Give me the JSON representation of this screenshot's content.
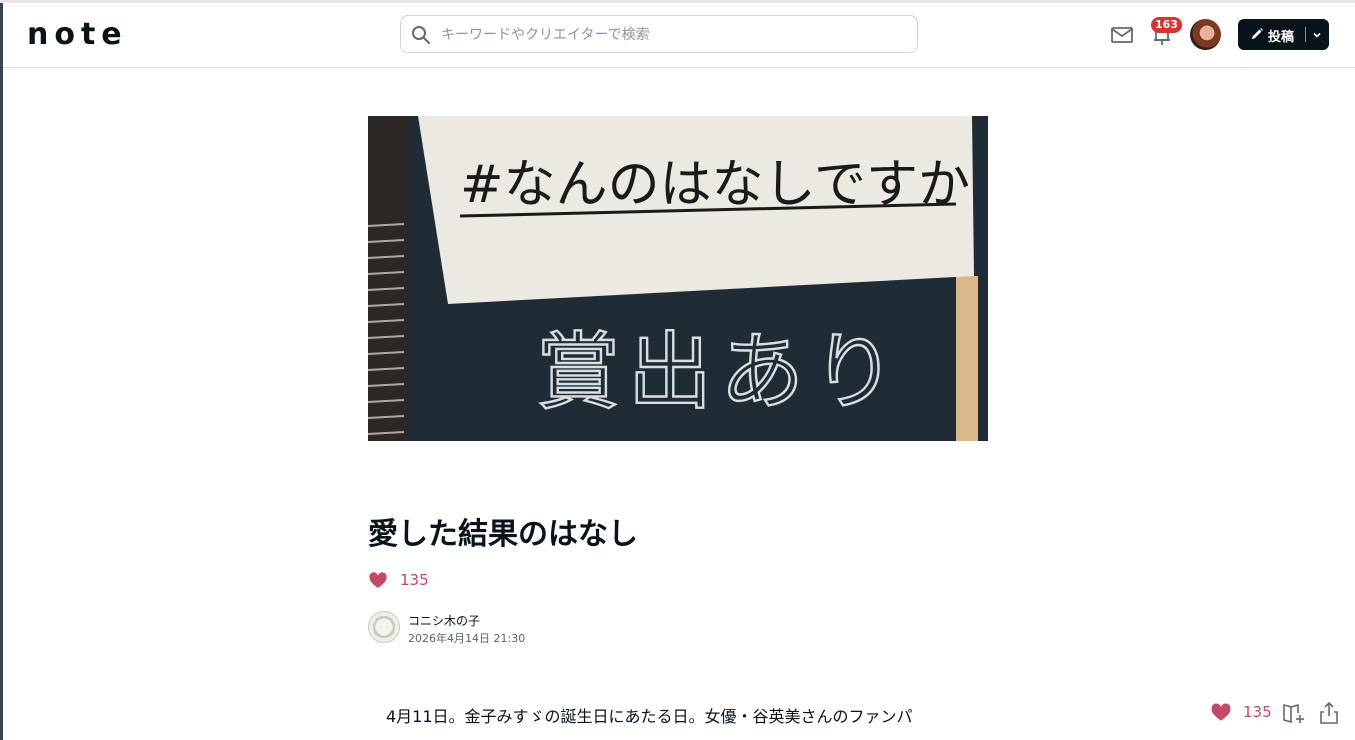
{
  "header": {
    "logo_text": "note",
    "search": {
      "placeholder": "キーワードやクリエイターで検索"
    },
    "notification_count": "163",
    "post_button_label": "投稿",
    "icons": [
      "search-icon",
      "mail-icon",
      "bell-icon",
      "pencil-icon",
      "chevron-down-icon"
    ]
  },
  "hero": {
    "sign_text": "#なんのはなしですか",
    "chalk_text": "賞出あり"
  },
  "article": {
    "title": "愛した結果のはなし",
    "like_count": "135",
    "author_name": "コニシ木の子",
    "published": "2026年4月14日 21:30",
    "body_first_line": "4月11日。金子みすゞの誕生日にあたる日。女優・谷英美さんのファンパ"
  },
  "floating_actions": {
    "like_count": "135",
    "icons": [
      "heart-icon",
      "magazine-add-icon",
      "share-icon"
    ]
  },
  "colors": {
    "brand_dark": "#08131a",
    "like_pink": "#c54867",
    "badge_red": "#d6342c"
  }
}
